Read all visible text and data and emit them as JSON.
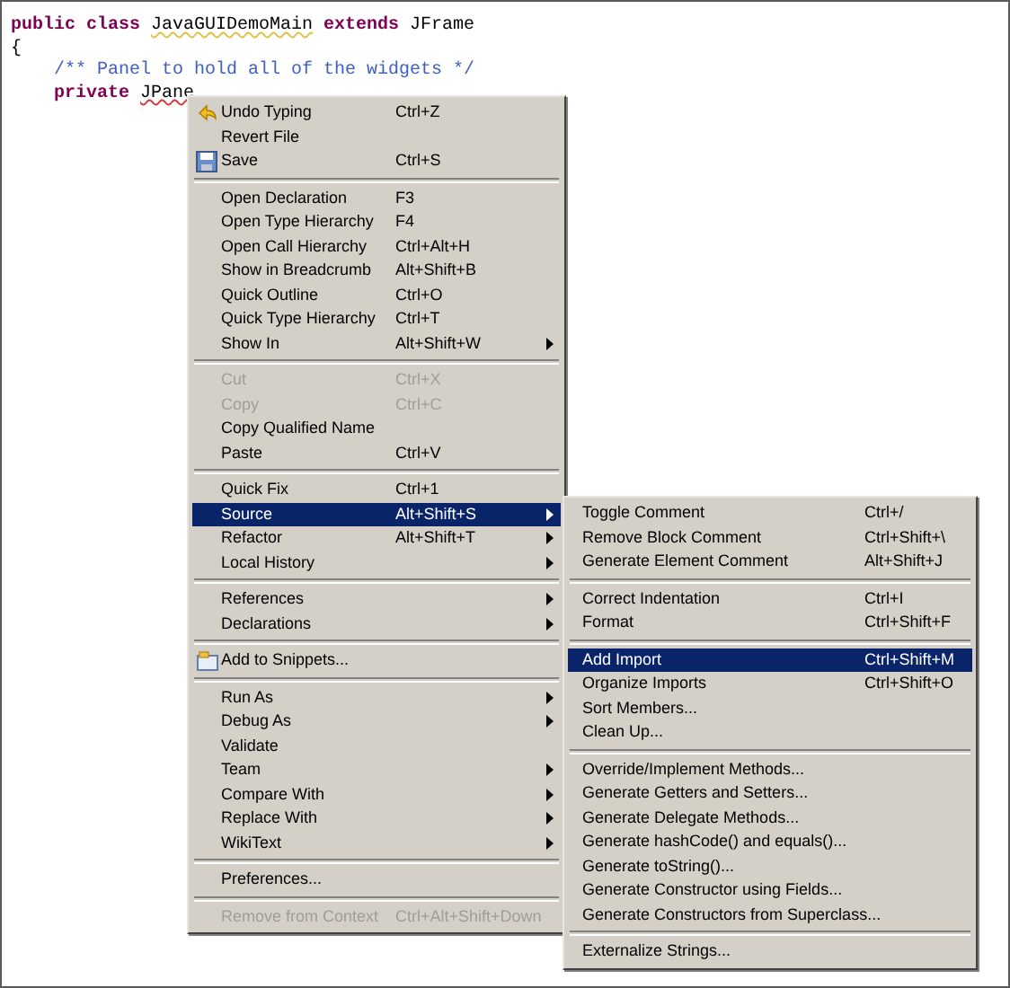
{
  "code_lines": [
    {
      "tokens": [
        {
          "kind": "keyword",
          "text": "public class "
        },
        {
          "kind": "plain",
          "text": "JavaGUIDemoMain",
          "warning": true
        },
        {
          "kind": "keyword",
          "text": " extends "
        },
        {
          "kind": "plain",
          "text": "JFrame",
          "warning": false
        }
      ]
    },
    {
      "tokens": [
        {
          "kind": "plain",
          "text": "{",
          "warning": false
        }
      ]
    },
    {
      "tokens": [
        {
          "kind": "comment",
          "text": "    /** Panel to hold all of the widgets */"
        }
      ]
    },
    {
      "tokens": [
        {
          "kind": "keyword",
          "text": "    private "
        },
        {
          "kind": "plain",
          "text": "JPane",
          "error": true
        }
      ]
    }
  ],
  "context_menu": {
    "items": [
      {
        "kind": "icon_item",
        "label": "Undo Typing",
        "shortcut": "Ctrl+Z",
        "submenu": false,
        "disabled": false,
        "selected": false
      },
      {
        "kind": "item",
        "label": "Revert File",
        "submenu": false,
        "disabled": false,
        "selected": false
      },
      {
        "kind": "icon_item",
        "label": "Save",
        "shortcut": "Ctrl+S",
        "submenu": false,
        "disabled": false,
        "selected": false
      },
      {
        "kind": "separator"
      },
      {
        "kind": "item",
        "label": "Open Declaration",
        "shortcut": "F3",
        "submenu": false,
        "disabled": false,
        "selected": false
      },
      {
        "kind": "item",
        "label": "Open Type Hierarchy",
        "shortcut": "F4",
        "submenu": false,
        "disabled": false,
        "selected": false
      },
      {
        "kind": "item",
        "label": "Open Call Hierarchy",
        "shortcut": "Ctrl+Alt+H",
        "submenu": false,
        "disabled": false,
        "selected": false
      },
      {
        "kind": "item",
        "label": "Show in Breadcrumb",
        "shortcut": "Alt+Shift+B",
        "submenu": false,
        "disabled": false,
        "selected": false
      },
      {
        "kind": "item",
        "label": "Quick Outline",
        "shortcut": "Ctrl+O",
        "submenu": false,
        "disabled": false,
        "selected": false
      },
      {
        "kind": "item",
        "label": "Quick Type Hierarchy",
        "shortcut": "Ctrl+T",
        "submenu": false,
        "disabled": false,
        "selected": false
      },
      {
        "kind": "item",
        "label": "Show In",
        "shortcut": "Alt+Shift+W",
        "submenu": true,
        "disabled": false,
        "selected": false
      },
      {
        "kind": "separator"
      },
      {
        "kind": "item",
        "label": "Cut",
        "shortcut": "Ctrl+X",
        "submenu": false,
        "disabled": true,
        "selected": false
      },
      {
        "kind": "item",
        "label": "Copy",
        "shortcut": "Ctrl+C",
        "submenu": false,
        "disabled": true,
        "selected": false
      },
      {
        "kind": "item",
        "label": "Copy Qualified Name",
        "submenu": false,
        "disabled": false,
        "selected": false
      },
      {
        "kind": "item",
        "label": "Paste",
        "shortcut": "Ctrl+V",
        "submenu": false,
        "disabled": false,
        "selected": false
      },
      {
        "kind": "separator"
      },
      {
        "kind": "item",
        "label": "Quick Fix",
        "shortcut": "Ctrl+1",
        "submenu": false,
        "disabled": false,
        "selected": false
      },
      {
        "kind": "item",
        "label": "Source",
        "shortcut": "Alt+Shift+S",
        "submenu": true,
        "disabled": false,
        "selected": true
      },
      {
        "kind": "item",
        "label": "Refactor",
        "shortcut": "Alt+Shift+T",
        "submenu": true,
        "disabled": false,
        "selected": false
      },
      {
        "kind": "item",
        "label": "Local History",
        "submenu": true,
        "disabled": false,
        "selected": false
      },
      {
        "kind": "separator"
      },
      {
        "kind": "item",
        "label": "References",
        "submenu": true,
        "disabled": false,
        "selected": false
      },
      {
        "kind": "item",
        "label": "Declarations",
        "submenu": true,
        "disabled": false,
        "selected": false
      },
      {
        "kind": "separator"
      },
      {
        "kind": "icon_item",
        "label": "Add to Snippets...",
        "submenu": false,
        "disabled": false,
        "selected": false
      },
      {
        "kind": "separator"
      },
      {
        "kind": "item",
        "label": "Run As",
        "submenu": true,
        "disabled": false,
        "selected": false
      },
      {
        "kind": "item",
        "label": "Debug As",
        "submenu": true,
        "disabled": false,
        "selected": false
      },
      {
        "kind": "item",
        "label": "Validate",
        "submenu": false,
        "disabled": false,
        "selected": false
      },
      {
        "kind": "item",
        "label": "Team",
        "submenu": true,
        "disabled": false,
        "selected": false
      },
      {
        "kind": "item",
        "label": "Compare With",
        "submenu": true,
        "disabled": false,
        "selected": false
      },
      {
        "kind": "item",
        "label": "Replace With",
        "submenu": true,
        "disabled": false,
        "selected": false
      },
      {
        "kind": "item",
        "label": "WikiText",
        "submenu": true,
        "disabled": false,
        "selected": false
      },
      {
        "kind": "separator"
      },
      {
        "kind": "item",
        "label": "Preferences...",
        "submenu": false,
        "disabled": false,
        "selected": false
      },
      {
        "kind": "separator"
      },
      {
        "kind": "item",
        "label": "Remove from Context",
        "shortcut": "Ctrl+Alt+Shift+Down",
        "submenu": false,
        "disabled": true,
        "selected": false
      }
    ]
  },
  "source_submenu": {
    "items": [
      {
        "kind": "item",
        "label": "Toggle Comment",
        "shortcut": "Ctrl+/",
        "selected": false
      },
      {
        "kind": "item",
        "label": "Remove Block Comment",
        "shortcut": "Ctrl+Shift+\\",
        "selected": false
      },
      {
        "kind": "item",
        "label": "Generate Element Comment",
        "shortcut": "Alt+Shift+J",
        "selected": false
      },
      {
        "kind": "separator"
      },
      {
        "kind": "item",
        "label": "Correct Indentation",
        "shortcut": "Ctrl+I",
        "selected": false
      },
      {
        "kind": "item",
        "label": "Format",
        "shortcut": "Ctrl+Shift+F",
        "selected": false
      },
      {
        "kind": "separator"
      },
      {
        "kind": "item",
        "label": "Add Import",
        "shortcut": "Ctrl+Shift+M",
        "selected": true
      },
      {
        "kind": "item",
        "label": "Organize Imports",
        "shortcut": "Ctrl+Shift+O",
        "selected": false
      },
      {
        "kind": "item",
        "label": "Sort Members...",
        "selected": false
      },
      {
        "kind": "item",
        "label": "Clean Up...",
        "selected": false
      },
      {
        "kind": "separator"
      },
      {
        "kind": "item",
        "label": "Override/Implement Methods...",
        "selected": false
      },
      {
        "kind": "item",
        "label": "Generate Getters and Setters...",
        "selected": false
      },
      {
        "kind": "item",
        "label": "Generate Delegate Methods...",
        "selected": false
      },
      {
        "kind": "item",
        "label": "Generate hashCode() and equals()...",
        "selected": false
      },
      {
        "kind": "item",
        "label": "Generate toString()...",
        "selected": false
      },
      {
        "kind": "item",
        "label": "Generate Constructor using Fields...",
        "selected": false
      },
      {
        "kind": "item",
        "label": "Generate Constructors from Superclass...",
        "selected": false
      },
      {
        "kind": "separator"
      },
      {
        "kind": "item",
        "label": "Externalize Strings...",
        "selected": false
      }
    ]
  }
}
